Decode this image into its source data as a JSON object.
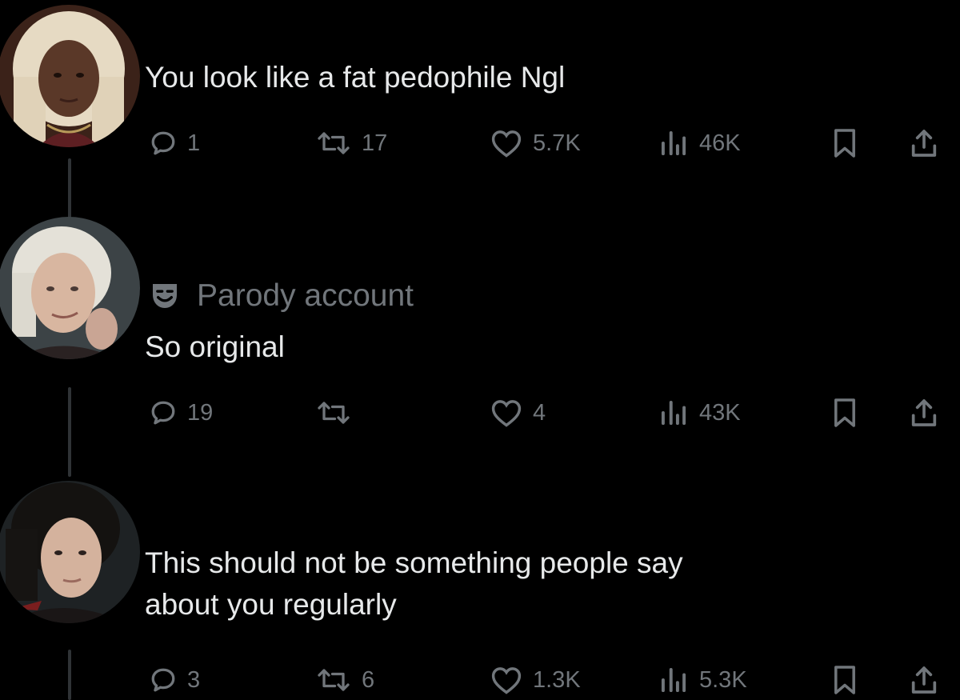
{
  "tweets": [
    {
      "text_lines": [
        "You look like a fat pedophile Ngl"
      ],
      "avatar": {
        "description": "woman-with-white-curly-hair-avatar",
        "bg": "#4a2a1c",
        "hair": "#e9ddc4",
        "skin": "#5b3a2b"
      },
      "replies": "1",
      "reposts": "17",
      "likes": "5.7K",
      "views": "46K"
    },
    {
      "badge": "Parody account",
      "text_lines": [
        "So original"
      ],
      "avatar": {
        "description": "man-with-platinum-hair-avatar",
        "bg": "#3e4548",
        "hair": "#e5e3db",
        "skin": "#d9b8a4"
      },
      "replies": "19",
      "reposts": "",
      "likes": "4",
      "views": "43K"
    },
    {
      "text_lines": [
        "This should not be something people say",
        "about you regularly"
      ],
      "avatar": {
        "description": "man-with-dark-curly-hair-avatar",
        "bg": "#1f2325",
        "hair": "#151312",
        "skin": "#d6b5a0"
      },
      "replies": "3",
      "reposts": "6",
      "likes": "1.3K",
      "views": "5.3K"
    }
  ],
  "colors": {
    "background": "#000000",
    "text": "#e7e9ea",
    "muted": "#71767b",
    "thread": "#2f3336"
  }
}
